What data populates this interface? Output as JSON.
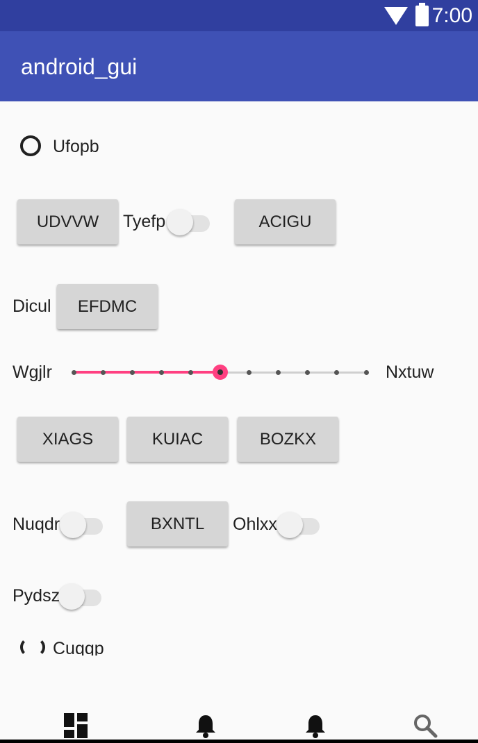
{
  "status_bar": {
    "time": "7:00"
  },
  "app_bar": {
    "title": "android_gui"
  },
  "radio_top": {
    "label": "Ufopb"
  },
  "row1": {
    "button1": "UDVVW",
    "switch_label": "Tyefp",
    "button2": "ACIGU"
  },
  "row2": {
    "label": "Dicul",
    "button": "EFDMC"
  },
  "slider": {
    "left_label": "Wgjlr",
    "right_label": "Nxtuw",
    "value": 5,
    "max": 10
  },
  "row3": {
    "buttons": [
      "XIAGS",
      "KUIAC",
      "BOZKX"
    ]
  },
  "row4": {
    "switch1_label": "Nuqdr",
    "button": "BXNTL",
    "switch2_label": "Ohlxx"
  },
  "row5": {
    "switch_label": "Pydsz"
  },
  "radio_bottom": {
    "label": "Cuqqp"
  },
  "bottom_nav": {
    "icons": [
      "dashboard-icon",
      "bell-icon",
      "bell-icon",
      "search-icon"
    ]
  },
  "colors": {
    "status_bar": "#303f9f",
    "app_bar": "#3f51b5",
    "accent": "#ff4081"
  }
}
